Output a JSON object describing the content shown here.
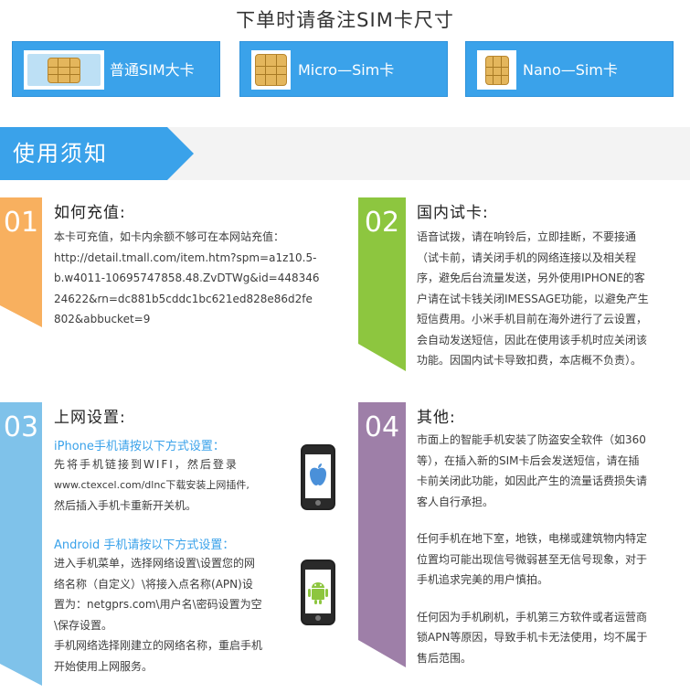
{
  "header": {
    "title": "下单时请备注SIM卡尺寸",
    "sim_options": [
      {
        "label": "普通SIM大卡",
        "icon": "standard-sim-card-icon"
      },
      {
        "label": "Micro—Sim卡",
        "icon": "micro-sim-card-icon"
      },
      {
        "label": "Nano—Sim卡",
        "icon": "nano-sim-card-icon"
      }
    ]
  },
  "banner": {
    "title": "使用须知",
    "color": "#3aa2ea"
  },
  "sections": {
    "s01": {
      "number": "01",
      "color": "#f8b05f",
      "title": "如何充值:",
      "lines": [
        "本卡可充值，如卡内余额不够可在本网站充值：",
        "http://detail.tmall.com/item.htm?spm=a1z10.5-",
        "b.w4011-10695747858.48.ZvDTWg&id=448346",
        "24622&rn=dc881b5cddc1bc621ed828e86d2fe",
        "802&abbucket=9"
      ]
    },
    "s02": {
      "number": "02",
      "color": "#8dc63f",
      "title": "国内试卡:",
      "lines": [
        "语音试拨，请在响铃后，立即挂断，不要接通",
        "（试卡前，请关闭手机的网络连接以及相关程",
        "序，避免后台流量发送，另外使用IPHONE的客",
        "户请在试卡钱关闭IMESSAGE功能，以避免产生",
        "短信费用。小米手机目前在海外进行了云设置，",
        "会自动发送短信，因此在使用该手机时应关闭该",
        "功能。因国内试卡导致扣费，本店概不负责）。"
      ]
    },
    "s03": {
      "number": "03",
      "color": "#7fc2ea",
      "title": "上网设置:",
      "iphone_head": "iPhone手机请按以下方式设置：",
      "iphone_lines": [
        "先将手机链接到WIFI，然后登录",
        "www.ctexcel.com/dlnc下载安装上网插件,",
        "然后插入手机卡重新开关机。"
      ],
      "android_head": "Android 手机请按以下方式设置：",
      "android_lines": [
        "进入手机菜单，选择网络设置\\设置您的网",
        "络名称（自定义）\\将接入点名称(APN)设",
        "置为：netgprs.com\\用户名\\密码设置为空",
        "\\保存设置。",
        "手机网络选择刚建立的网络名称，重启手机",
        "开始使用上网服务。"
      ],
      "iphone_icon": "iphone-apple-icon",
      "android_icon": "android-phone-icon"
    },
    "s04": {
      "number": "04",
      "color": "#9e7fa8",
      "title": "其他:",
      "para1": [
        "市面上的智能手机安装了防盗安全软件（如360",
        "等），在插入新的SIM卡后会发送短信，请在插",
        "卡前关闭此功能，如因此产生的流量话费损失请",
        "客人自行承担。"
      ],
      "para2": [
        "任何手机在地下室，地铁，电梯或建筑物内特定",
        "位置均可能出现信号微弱甚至无信号现象，对于",
        "手机追求完美的用户慎拍。"
      ],
      "para3": [
        "任何因为手机刷机，手机第三方软件或者运营商",
        "锁APN等原因，导致手机卡无法使用，均不属于",
        "售后范围。"
      ]
    }
  }
}
